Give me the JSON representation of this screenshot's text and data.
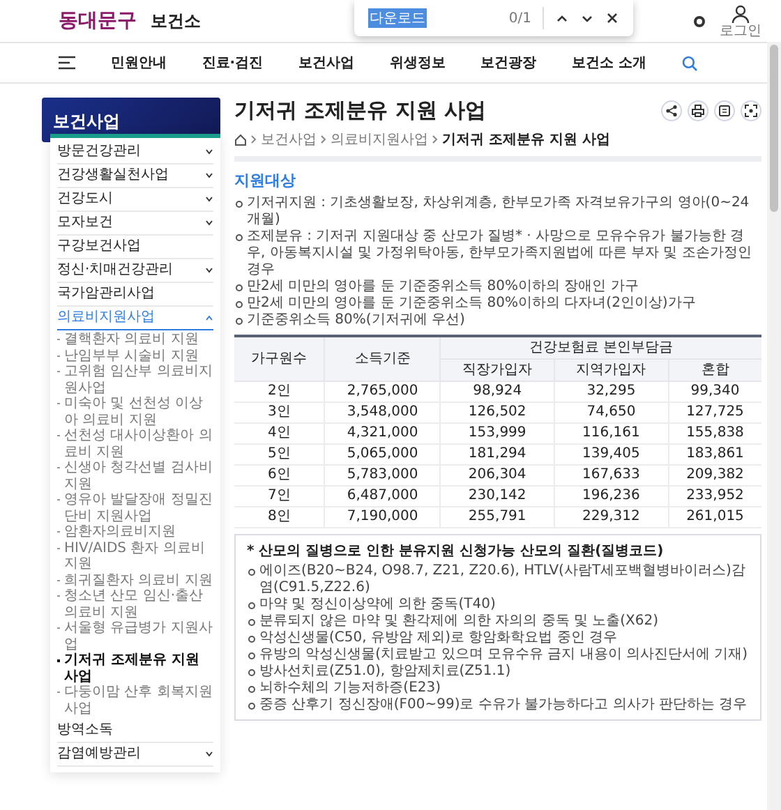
{
  "header": {
    "logo": "동대문구",
    "site_title": "보건소",
    "login_label": "로그인"
  },
  "find_bar": {
    "query": "다운로드",
    "count": "0/1"
  },
  "nav": {
    "items": [
      "민원안내",
      "진료·검진",
      "보건사업",
      "위생정보",
      "보건광장",
      "보건소 소개"
    ]
  },
  "sidebar": {
    "title": "보건사업",
    "items": [
      {
        "label": "방문건강관리",
        "kind": "group",
        "expanded": false,
        "selected": false
      },
      {
        "label": "건강생활실천사업",
        "kind": "group",
        "expanded": false,
        "selected": false
      },
      {
        "label": "건강도시",
        "kind": "group",
        "expanded": false,
        "selected": false
      },
      {
        "label": "모자보건",
        "kind": "group",
        "expanded": false,
        "selected": false
      },
      {
        "label": "구강보건사업",
        "kind": "link",
        "selected": false
      },
      {
        "label": "정신·치매건강관리",
        "kind": "group",
        "expanded": false,
        "selected": false
      },
      {
        "label": "국가암관리사업",
        "kind": "link",
        "selected": false
      },
      {
        "label": "의료비지원사업",
        "kind": "group",
        "expanded": true,
        "selected": true,
        "children": [
          {
            "label": "결핵환자 의료비 지원",
            "selected": false
          },
          {
            "label": "난임부부 시술비 지원",
            "selected": false
          },
          {
            "label": "고위험 임산부 의료비지원사업",
            "selected": false
          },
          {
            "label": "미숙아 및 선천성 이상아 의료비 지원",
            "selected": false
          },
          {
            "label": "선천성 대사이상환아 의료비 지원",
            "selected": false
          },
          {
            "label": "신생아 청각선별 검사비 지원",
            "selected": false
          },
          {
            "label": "영유아 발달장애 정밀진단비 지원사업",
            "selected": false
          },
          {
            "label": "암환자의료비지원",
            "selected": false
          },
          {
            "label": "HIV/AIDS 환자 의료비 지원",
            "selected": false
          },
          {
            "label": "희귀질환자 의료비 지원",
            "selected": false
          },
          {
            "label": "청소년 산모 임신·출산 의료비 지원",
            "selected": false
          },
          {
            "label": "서울형 유급병가 지원사업",
            "selected": false
          },
          {
            "label": "기저귀 조제분유 지원 사업",
            "selected": true
          },
          {
            "label": "다둥이맘 산후 회복지원사업",
            "selected": false
          }
        ]
      },
      {
        "label": "방역소독",
        "kind": "link",
        "selected": false
      },
      {
        "label": "감염예방관리",
        "kind": "group",
        "expanded": false,
        "selected": false
      }
    ]
  },
  "page": {
    "title": "기저귀 조제분유 지원 사업",
    "breadcrumb": [
      "보건사업",
      "의료비지원사업",
      "기저귀 조제분유 지원 사업"
    ]
  },
  "section": {
    "heading": "지원대상",
    "bullets": [
      "기저귀지원 : 기초생활보장, 차상위계층, 한부모가족 자격보유가구의 영아(0~24개월)",
      "조제분유 : 기저귀 지원대상 중 산모가 질병* · 사망으로 모유수유가 불가능한 경우, 아동복지시설 및 가정위탁아동, 한부모가족지원법에 따른 부자 및 조손가정인 경우",
      "만2세 미만의 영아를 둔 기준중위소득 80%이하의 장애인 가구",
      "만2세 미만의 영아를 둔 기준중위소득 80%이하의 다자녀(2인이상)가구",
      "기준중위소득 80%(기저귀에 우선)"
    ]
  },
  "table": {
    "columns": [
      "가구원수",
      "소득기준"
    ],
    "group_header": "건강보험료 본인부담금",
    "sub_columns": [
      "직장가입자",
      "지역가입자",
      "혼합"
    ],
    "rows": [
      [
        "2인",
        "2,765,000",
        "98,924",
        "32,295",
        "99,340"
      ],
      [
        "3인",
        "3,548,000",
        "126,502",
        "74,650",
        "127,725"
      ],
      [
        "4인",
        "4,321,000",
        "153,999",
        "116,161",
        "155,838"
      ],
      [
        "5인",
        "5,065,000",
        "181,294",
        "139,405",
        "183,861"
      ],
      [
        "6인",
        "5,783,000",
        "206,304",
        "167,633",
        "209,382"
      ],
      [
        "7인",
        "6,487,000",
        "230,142",
        "196,236",
        "233,952"
      ],
      [
        "8인",
        "7,190,000",
        "255,791",
        "229,312",
        "261,015"
      ]
    ]
  },
  "note_box": {
    "heading": "* 산모의 질병으로 인한 분유지원 신청가능 산모의 질환(질병코드)",
    "items": [
      "에이즈(B20~B24, O98.7, Z21, Z20.6), HTLV(사람T세포백혈병바이러스)감염(C91.5,Z22.6)",
      "마약 및 정신이상약에 의한 중독(T40)",
      "분류되지 않은 마약 및 환각제에 의한 자의의 중독 및 노출(X62)",
      "악성신생물(C50, 유방암 제외)로 항암화학요법 중인 경우",
      "유방의 악성신생물(치료받고 있으며 모유수유 금지 내용이 의사진단서에 기재)",
      "방사선치료(Z51.0), 항암제치료(Z51.1)",
      "뇌하수체의 기능저하증(E23)",
      "중증 산후기 정신장애(F00~99)로 수유가 불가능하다고 의사가 판단하는 경우"
    ]
  }
}
